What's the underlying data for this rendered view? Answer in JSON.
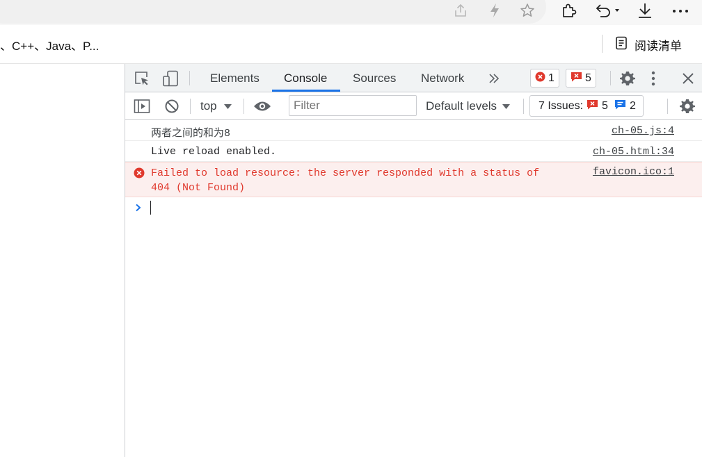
{
  "favorites": {
    "item_text": "、C++、Java、P...",
    "reading_list_label": "阅读清单"
  },
  "devtools": {
    "tabs": [
      {
        "label": "Elements"
      },
      {
        "label": "Console"
      },
      {
        "label": "Sources"
      },
      {
        "label": "Network"
      }
    ],
    "error_badge_count": "1",
    "warning_badge_count": "5",
    "context_select": "top",
    "filter_placeholder": "Filter",
    "levels_select": "Default levels",
    "issues": {
      "label": "7 Issues:",
      "error_count": "5",
      "info_count": "2"
    },
    "messages": [
      {
        "text": "两者之间的和为8",
        "source": "ch-05.js:4",
        "level": "log"
      },
      {
        "text": "Live reload enabled.",
        "source": "ch-05.html:34",
        "level": "log"
      },
      {
        "text_line1": "Failed to load resource: the server responded with a status of",
        "text_line2": "404 (Not Found)",
        "source": "favicon.ico:1",
        "level": "error"
      }
    ]
  },
  "colors": {
    "accent": "#1a73e8",
    "error": "#e0392d",
    "error_bg": "#fcefee"
  },
  "icons": [
    "share-icon",
    "lightning-icon",
    "star-icon",
    "extensions-icon",
    "undo-icon",
    "download-icon",
    "more-icon",
    "reading-list-icon",
    "inspect-icon",
    "device-toggle-icon",
    "more-tabs-icon",
    "settings-icon",
    "kebab-icon",
    "close-icon",
    "sidebar-toggle-icon",
    "clear-console-icon",
    "eye-icon",
    "prompt-chevron-icon"
  ]
}
